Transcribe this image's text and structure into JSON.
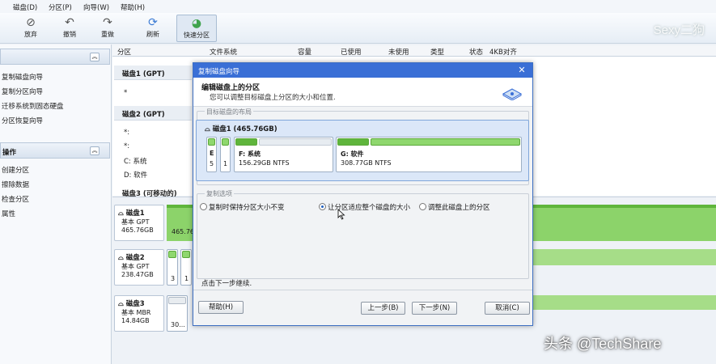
{
  "menu": [
    "磁盘(D)",
    "分区(P)",
    "向导(W)",
    "帮助(H)"
  ],
  "toolbar": {
    "discard": "放弃",
    "undo": "撤销",
    "redo": "重做",
    "refresh": "刷新",
    "quick_partition": "快速分区",
    "watermark": "Sexy二狗"
  },
  "left_panel": {
    "wizard_items": [
      "复制磁盘向导",
      "复制分区向导",
      "迁移系统到固态硬盘",
      "分区恢复向导"
    ],
    "ops_header": "操作",
    "ops_items": [
      "创建分区",
      "擦除数据",
      "检查分区",
      "属性"
    ]
  },
  "columns": [
    "分区",
    "文件系统",
    "容量",
    "已使用",
    "未使用",
    "类型",
    "状态",
    "4KB对齐"
  ],
  "partition_table": {
    "disk1": "磁盘1 (GPT)",
    "disk1_row": "*",
    "disk2": "磁盘2 (GPT)",
    "disk2_rows": [
      "*:",
      "*:",
      "C: 系统",
      "D: 软件"
    ],
    "disk3": "磁盘3 (可移动的)"
  },
  "disk_map": {
    "disk1": {
      "name": "磁盘1",
      "type": "基本 GPT",
      "size": "465.76GB",
      "bar_label": "465.76"
    },
    "disk2": {
      "name": "磁盘2",
      "type": "基本 GPT",
      "size": "238.47GB",
      "p1": "3",
      "p2": "1"
    },
    "disk3": {
      "name": "磁盘3",
      "type": "基本 MBR",
      "size": "14.84GB",
      "p1": "30..."
    }
  },
  "dialog": {
    "title": "复制磁盘向导",
    "heading": "编辑磁盘上的分区",
    "subheading": "您可以调整目标磁盘上分区的大小和位置.",
    "target_group": "目标磁盘的布局",
    "target_disk": "磁盘1 (465.76GB)",
    "small1_a": "E",
    "small1_b": "5",
    "small2_a": "1",
    "f_name": "F: 系统",
    "f_info": "156.29GB NTFS",
    "g_name": "G: 软件",
    "g_info": "308.77GB NTFS",
    "copy_group": "复制选项",
    "options": [
      "复制时保持分区大小不变",
      "让分区适应整个磁盘的大小",
      "调整此磁盘上的分区"
    ],
    "selected_option": 1,
    "hint": "点击下一步继续.",
    "buttons": {
      "help": "帮助(H)",
      "back": "上一步(B)",
      "next": "下一步(N)",
      "cancel": "取消(C)"
    }
  },
  "watermark_bottom": "头条 @TechShare"
}
